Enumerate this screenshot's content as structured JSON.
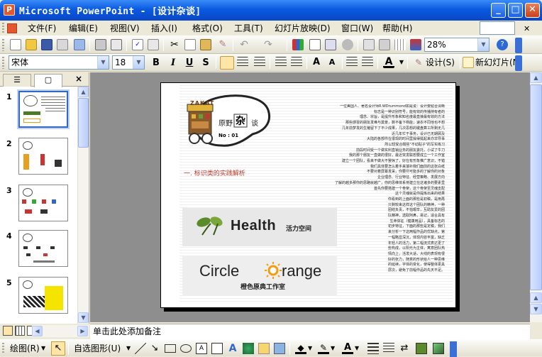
{
  "window": {
    "title": "Microsoft PowerPoint - [设计杂谈]",
    "app_icon": "powerpoint-icon"
  },
  "window_controls": {
    "minimize": "_",
    "maximize": "□",
    "close": "✕"
  },
  "menu": [
    "文件(F)",
    "编辑(E)",
    "视图(V)",
    "插入(I)",
    "格式(O)",
    "工具(T)",
    "幻灯片放映(D)",
    "窗口(W)",
    "帮助(H)"
  ],
  "standard_toolbar": {
    "zoom": "28%"
  },
  "formatting_toolbar": {
    "font": "宋体",
    "size": "18",
    "bold": "B",
    "italic": "I",
    "underline": "U",
    "shadow": "S",
    "design_label": "设计(S)",
    "new_slide_label": "新幻灯片(N)"
  },
  "slide_pane": {
    "tab_outline": "☰",
    "tab_slides": "▢",
    "close": "×",
    "slides": [
      {
        "num": "1"
      },
      {
        "num": "2"
      },
      {
        "num": "3"
      },
      {
        "num": "4"
      },
      {
        "num": "5"
      }
    ],
    "selected": 1
  },
  "slide": {
    "header_sign": "ZAKAT",
    "title_left": "原野",
    "title_center": "杂",
    "title_right": "谈",
    "issue": "No : 01",
    "section_heading": "一. 标识类的实践解析",
    "body_lines": [
      "一位美国人、著名设计师R.WDrummond如是说：设计要贴合清晰",
      "标志是一种识别符号，能有效的传播持有者的",
      "理念、宗旨，是提升形象和知名度最直接最有效的方法",
      "那些感冒的朋友发难与莫景，数不备下杨能；速衣不同他也不想",
      "几年前梦发的生猪留下了不少成果，几次思想的键盘算工所剩无几",
      "近几年忙于事务，设计已无期顾及",
      "大陆的各部件在很现的时间里操得挺起来亦非导事",
      "所以轻受合帽些\"不动贴子\"的写实练习",
      "前段时间受一个做实利直销业务的朋友委托，小试了牛刀",
      "我的那个朋友一直做的很好，最近突发联想要成立一个工作室",
      "建立一个团队，看来不做大不罢休了，好在有形象推广意识，不错",
      "我们具体要怎么着手来填补我们面前的这张白纸",
      "不要对着屏幕发呆，你要尽可能多的了解你的对象",
      "企业理念、行业特征、经营策略、发展方向",
      "了解的越多那你的思路就越广，你的思维体系将建立在这诸多的要素里",
      "首先你要搭建一个骨架，这个骨架至灵魂支配",
      "这个灵魂就是你提炼出来的结果",
      "你看到的上面的那些是初稿，是用再",
      "只剩较来这样这个团队的精神，一种",
      "团结负责，不怕艰辛，互助友爱的团",
      "队精神，选取阿鼻，易记，适合具有",
      "生命体征（健康用品），具备标志的",
      "初步特征，下面的那些是定稿，我们",
      "来分析一下这两幅作品的优缺点，第",
      "一幅略显深沉，体现内容丰富，缺乏",
      "年轻人的活力，第二幅流式表达更了",
      "些构成，以阳光为主体，寓意团队热",
      "情向上，活泼大适，大线的表现有很",
      "好的张力，随意的形状给人一种思维",
      "的延续，字体的变化，使得整体更具",
      "层次，避免了前幅作品的先天不足。"
    ],
    "logo1_text": "Health",
    "logo1_sub": "活力空间",
    "logo2_text_a": "Circle",
    "logo2_text_b": "range",
    "logo2_sub": "橙色原典工作室"
  },
  "notes_placeholder": "单击此处添加备注",
  "drawing_toolbar": {
    "draw_label": "绘图(R)",
    "autoshape_label": "自选图形(U)"
  },
  "colors": {
    "title_bar": "#0A5AE0",
    "workspace": "#8E8E8E",
    "selection": "#316AC5",
    "accent_red": "#C0392B",
    "orange": "#F39C12"
  }
}
